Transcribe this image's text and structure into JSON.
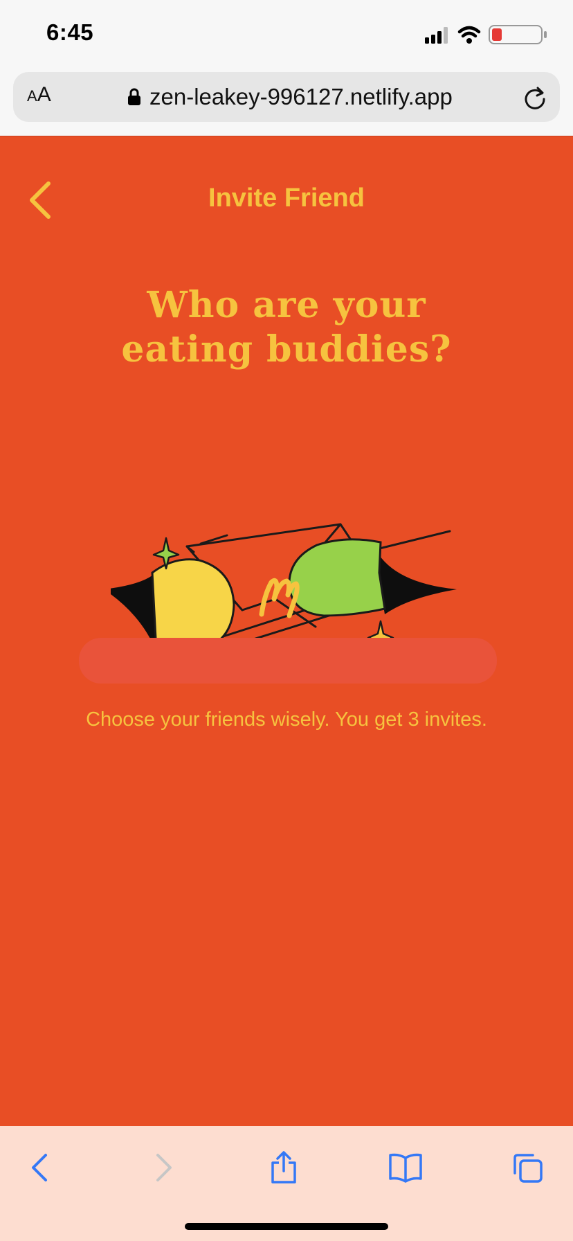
{
  "status_bar": {
    "time": "6:45",
    "icons": [
      "signal-icon",
      "wifi-icon",
      "battery-icon"
    ]
  },
  "browser": {
    "aa_label_small": "A",
    "aa_label_large": "A",
    "url": "zen-leakey-996127.netlify.app",
    "lock_icon": "lock-icon",
    "reload_icon": "reload-icon"
  },
  "app": {
    "header_title": "Invite Friend",
    "headline_line1": "Who are your",
    "headline_line2": "eating buddies?",
    "input_value": "",
    "caption": "Choose your friends wisely. You get 3 invites."
  },
  "toolbar": {
    "icons": [
      "back-icon",
      "forward-icon",
      "share-icon",
      "bookmarks-icon",
      "tabs-icon"
    ]
  },
  "colors": {
    "background": "#e84e25",
    "accent": "#f6c33f",
    "toolbar": "#fdddd0",
    "ios_blue": "#3478f6"
  }
}
